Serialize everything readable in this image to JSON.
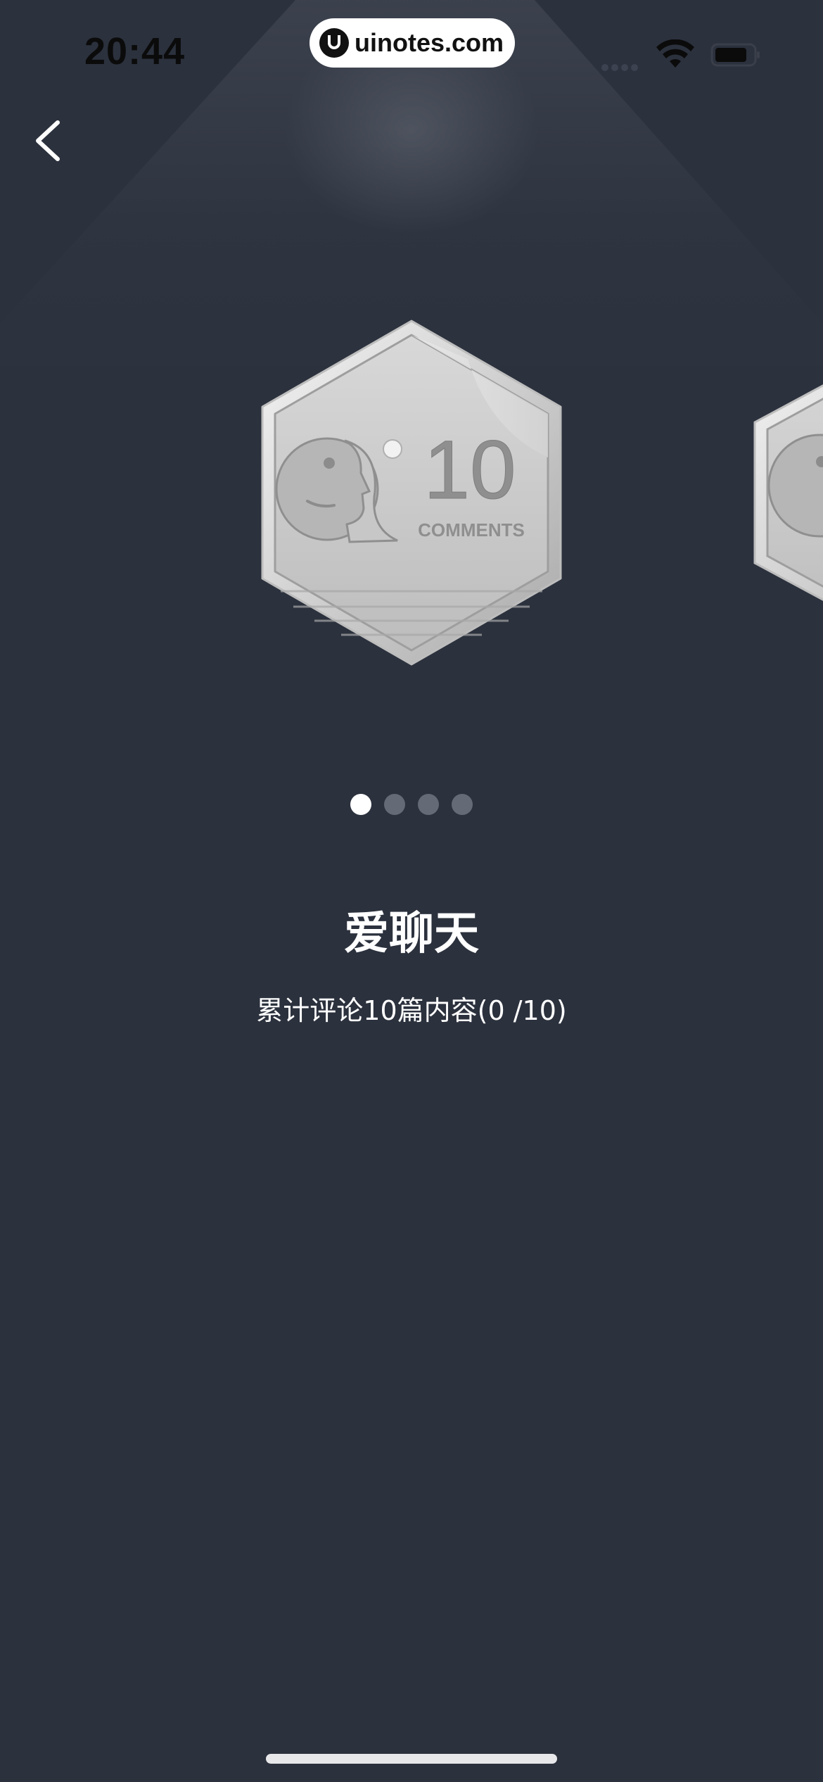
{
  "status_bar": {
    "time": "20:44"
  },
  "watermark": {
    "text": "uinotes.com"
  },
  "badge": {
    "number": "10",
    "caption": "COMMENTS",
    "title": "爱聊天",
    "description": "累计评论10篇内容(0  /10)"
  },
  "pager": {
    "total": 4,
    "active_index": 0
  },
  "colors": {
    "background": "#2b313d",
    "dot_active": "#ffffff",
    "dot_inactive": "#646a76",
    "badge_silver": "#c9c9c9"
  },
  "icons": {
    "back": "chevron-left-icon",
    "wifi": "wifi-icon",
    "battery": "battery-icon"
  }
}
